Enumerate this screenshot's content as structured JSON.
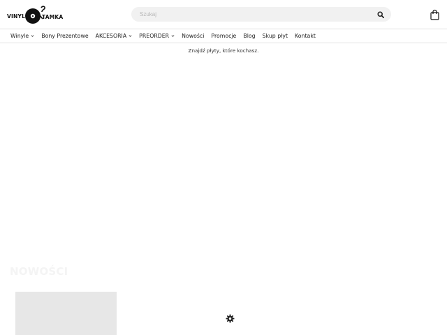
{
  "header": {
    "logo": {
      "word_left": "VINYL",
      "word_right": "TAMKA"
    },
    "search": {
      "placeholder": "Szukaj",
      "value": ""
    },
    "icons": {
      "search": "search-icon",
      "cart": "shopping-bag-icon"
    }
  },
  "nav": {
    "items": [
      {
        "label": "Winyle",
        "dropdown": true
      },
      {
        "label": "Bony Prezentowe",
        "dropdown": false
      },
      {
        "label": "AKCESORIA",
        "dropdown": true
      },
      {
        "label": "PREORDER",
        "dropdown": true
      },
      {
        "label": "Nowości",
        "dropdown": false
      },
      {
        "label": "Promocje",
        "dropdown": false
      },
      {
        "label": "Blog",
        "dropdown": false
      },
      {
        "label": "Skup płyt",
        "dropdown": false
      },
      {
        "label": "Kontakt",
        "dropdown": false
      }
    ]
  },
  "main": {
    "tagline": "Znajdź płyty, które kochasz.",
    "section_title": "NOWOŚCI"
  },
  "icons": {
    "settings": "gear-icon"
  },
  "colors": {
    "accent": "#111111",
    "search_bg": "#f1f1f1",
    "divider": "#e2e2e2",
    "placeholder_block": "#e7e7e7"
  }
}
